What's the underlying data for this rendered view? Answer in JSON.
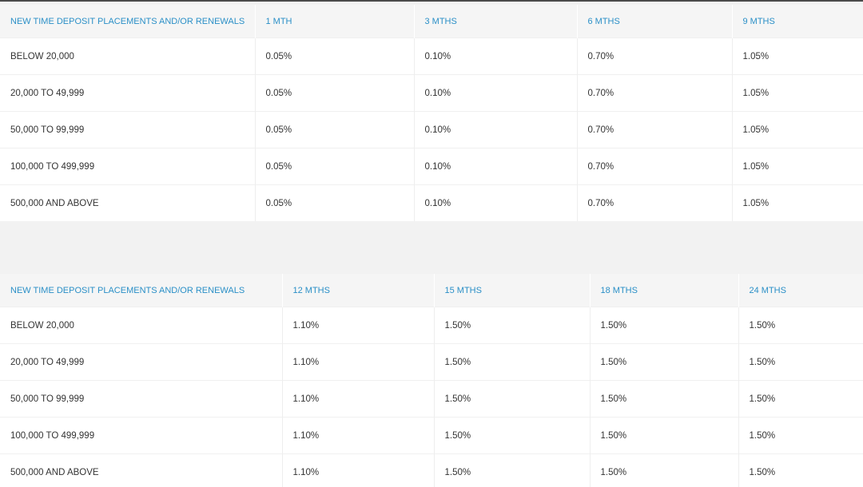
{
  "tables": [
    {
      "headers": [
        "NEW TIME DEPOSIT PLACEMENTS AND/OR RENEWALS",
        "1 MTH",
        "3 MTHS",
        "6 MTHS",
        "9 MTHS"
      ],
      "rows": [
        [
          "BELOW 20,000",
          "0.05%",
          "0.10%",
          "0.70%",
          "1.05%"
        ],
        [
          "20,000 TO 49,999",
          "0.05%",
          "0.10%",
          "0.70%",
          "1.05%"
        ],
        [
          "50,000 TO 99,999",
          "0.05%",
          "0.10%",
          "0.70%",
          "1.05%"
        ],
        [
          "100,000 TO 499,999",
          "0.05%",
          "0.10%",
          "0.70%",
          "1.05%"
        ],
        [
          "500,000 AND ABOVE",
          "0.05%",
          "0.10%",
          "0.70%",
          "1.05%"
        ]
      ]
    },
    {
      "headers": [
        "NEW TIME DEPOSIT PLACEMENTS AND/OR RENEWALS",
        "12 MTHS",
        "15 MTHS",
        "18 MTHS",
        "24 MTHS"
      ],
      "rows": [
        [
          "BELOW 20,000",
          "1.10%",
          "1.50%",
          "1.50%",
          "1.50%"
        ],
        [
          "20,000 TO 49,999",
          "1.10%",
          "1.50%",
          "1.50%",
          "1.50%"
        ],
        [
          "50,000 TO 99,999",
          "1.10%",
          "1.50%",
          "1.50%",
          "1.50%"
        ],
        [
          "100,000 TO 499,999",
          "1.10%",
          "1.50%",
          "1.50%",
          "1.50%"
        ],
        [
          "500,000 AND ABOVE",
          "1.10%",
          "1.50%",
          "1.50%",
          "1.50%"
        ]
      ]
    }
  ]
}
